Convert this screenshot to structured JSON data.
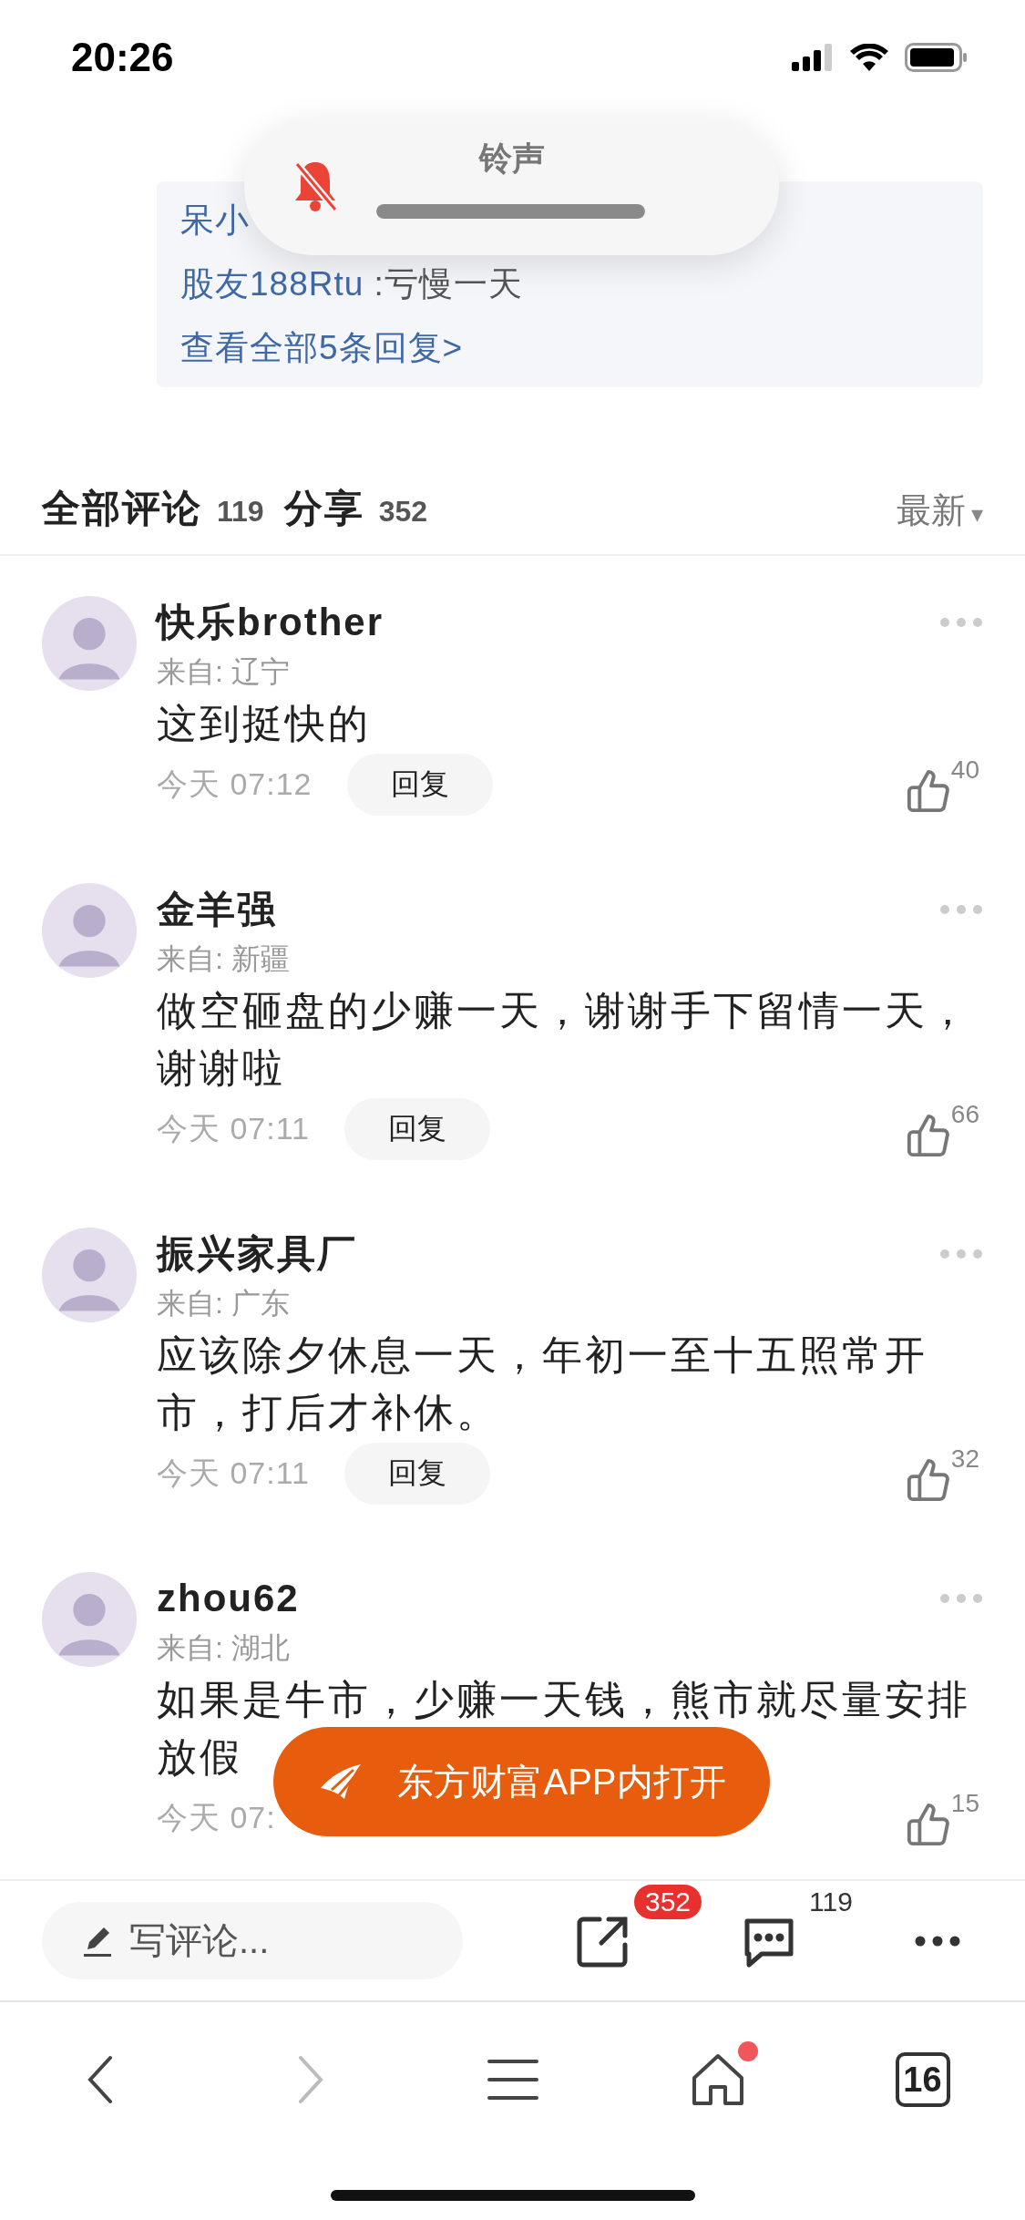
{
  "status_bar": {
    "time": "20:26"
  },
  "replies": {
    "items": [
      {
        "author": "呆小"
      },
      {
        "author": "股友188Rtu",
        "text": ":亏慢一天"
      }
    ],
    "more_link": "查看全部5条回复>"
  },
  "ringer_hud": {
    "label": "铃声",
    "muted": true,
    "level": 1
  },
  "comments_header": {
    "items": [
      {
        "label": "全部评论",
        "count": "119"
      },
      {
        "label": "分享",
        "count": "352"
      }
    ],
    "sort": "最新",
    "sort_icon": "▾"
  },
  "comments": [
    {
      "name": "快乐brother",
      "location": "来自: 辽宁",
      "text": [
        "这到挺快的"
      ],
      "time": "今天 07:12",
      "reply": "回复",
      "likes": "40"
    },
    {
      "name": "金羊强",
      "location": "来自: 新疆",
      "text": [
        "做空砸盘的少赚一天，谢谢手下留情一天，",
        "谢谢啦"
      ],
      "time": "今天 07:11",
      "reply": "回复",
      "likes": "66"
    },
    {
      "name": "振兴家具厂",
      "location": "来自: 广东",
      "text": [
        "应该除夕休息一天，年初一至十五照常开",
        "市，打后才补休。"
      ],
      "time": "今天 07:11",
      "reply": "回复",
      "likes": "32"
    },
    {
      "name": "zhou62",
      "location": "来自: 湖北",
      "text": [
        "如果是牛市，少赚一天钱，熊市就尽量安排",
        "放假"
      ],
      "time": "今天 07:",
      "likes": "15"
    }
  ],
  "open_in_app_button": {
    "label": "东方财富APP内打开"
  },
  "action_bar": {
    "comment_field": {
      "placeholder": "写评论..."
    },
    "share_count": "352",
    "comment_count": "119"
  },
  "browser_toolbar": {
    "back_disabled": false,
    "forward_disabled": true,
    "home_badge": true,
    "tab_count": "16"
  }
}
